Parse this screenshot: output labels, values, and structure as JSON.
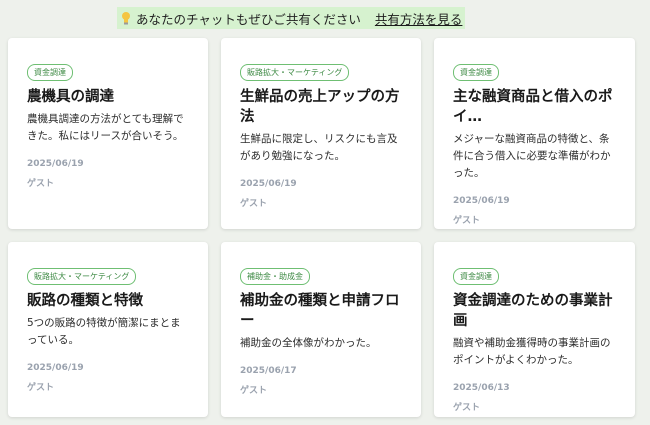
{
  "banner": {
    "icon": "lightbulb-icon",
    "message": "あなたのチャットもぜひご共有ください",
    "link_label": "共有方法を見る"
  },
  "colors": {
    "banner_bg": "#d6f2cf",
    "badge_green": "#3e8a44",
    "meta_gray": "#9aa2ae"
  },
  "cards": [
    {
      "category": "資金調達",
      "title": "農機具の調達",
      "description": "農機具調達の方法がとても理解できた。私にはリースが合いそう。",
      "date": "2025/06/19",
      "author": "ゲスト"
    },
    {
      "category": "販路拡大・マーケティング",
      "title": "生鮮品の売上アップの方法",
      "description": "生鮮品に限定し、リスクにも言及があり勉強になった。",
      "date": "2025/06/19",
      "author": "ゲスト"
    },
    {
      "category": "資金調達",
      "title": "主な融資商品と借入のポイ…",
      "description": "メジャーな融資商品の特徴と、条件に合う借入に必要な準備がわかった。",
      "date": "2025/06/19",
      "author": "ゲスト"
    },
    {
      "category": "販路拡大・マーケティング",
      "title": "販路の種類と特徴",
      "description": "5つの販路の特徴が簡潔にまとまっている。",
      "date": "2025/06/19",
      "author": "ゲスト"
    },
    {
      "category": "補助金・助成金",
      "title": "補助金の種類と申請フロー",
      "description": "補助金の全体像がわかった。",
      "date": "2025/06/17",
      "author": "ゲスト"
    },
    {
      "category": "資金調達",
      "title": "資金調達のための事業計画",
      "description": "融資や補助金獲得時の事業計画のポイントがよくわかった。",
      "date": "2025/06/13",
      "author": "ゲスト"
    }
  ]
}
